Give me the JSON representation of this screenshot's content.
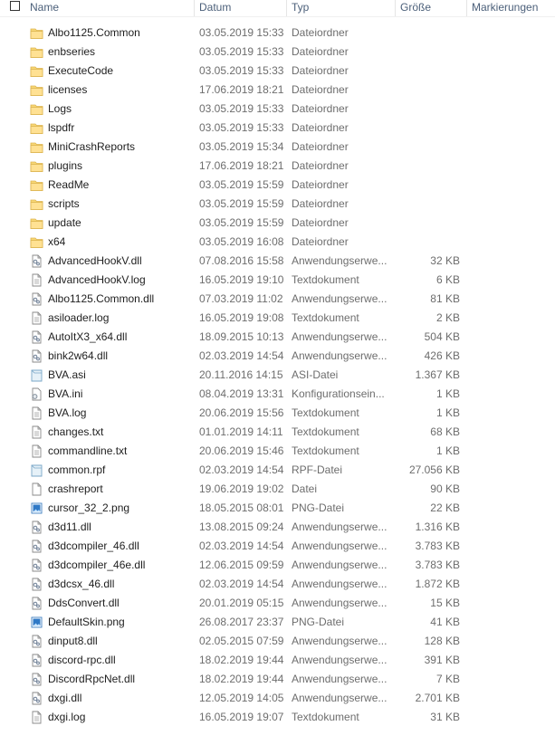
{
  "header": {
    "name": "Name",
    "date": "Datum",
    "type": "Typ",
    "size": "Größe",
    "tags": "Markierungen"
  },
  "files": [
    {
      "name": "Albo1125.Common",
      "date": "03.05.2019 15:33",
      "type": "Dateiordner",
      "size": "",
      "icon": "folder-icon"
    },
    {
      "name": "enbseries",
      "date": "03.05.2019 15:33",
      "type": "Dateiordner",
      "size": "",
      "icon": "folder-icon"
    },
    {
      "name": "ExecuteCode",
      "date": "03.05.2019 15:33",
      "type": "Dateiordner",
      "size": "",
      "icon": "folder-icon"
    },
    {
      "name": "licenses",
      "date": "17.06.2019 18:21",
      "type": "Dateiordner",
      "size": "",
      "icon": "folder-icon"
    },
    {
      "name": "Logs",
      "date": "03.05.2019 15:33",
      "type": "Dateiordner",
      "size": "",
      "icon": "folder-icon"
    },
    {
      "name": "lspdfr",
      "date": "03.05.2019 15:33",
      "type": "Dateiordner",
      "size": "",
      "icon": "folder-icon"
    },
    {
      "name": "MiniCrashReports",
      "date": "03.05.2019 15:34",
      "type": "Dateiordner",
      "size": "",
      "icon": "folder-icon"
    },
    {
      "name": "plugins",
      "date": "17.06.2019 18:21",
      "type": "Dateiordner",
      "size": "",
      "icon": "folder-icon"
    },
    {
      "name": "ReadMe",
      "date": "03.05.2019 15:59",
      "type": "Dateiordner",
      "size": "",
      "icon": "folder-icon"
    },
    {
      "name": "scripts",
      "date": "03.05.2019 15:59",
      "type": "Dateiordner",
      "size": "",
      "icon": "folder-icon"
    },
    {
      "name": "update",
      "date": "03.05.2019 15:59",
      "type": "Dateiordner",
      "size": "",
      "icon": "folder-icon"
    },
    {
      "name": "x64",
      "date": "03.05.2019 16:08",
      "type": "Dateiordner",
      "size": "",
      "icon": "folder-icon"
    },
    {
      "name": "AdvancedHookV.dll",
      "date": "07.08.2016 15:58",
      "type": "Anwendungserwe...",
      "size": "32 KB",
      "icon": "dll-icon"
    },
    {
      "name": "AdvancedHookV.log",
      "date": "16.05.2019 19:10",
      "type": "Textdokument",
      "size": "6 KB",
      "icon": "text-file-icon"
    },
    {
      "name": "Albo1125.Common.dll",
      "date": "07.03.2019 11:02",
      "type": "Anwendungserwe...",
      "size": "81 KB",
      "icon": "dll-icon"
    },
    {
      "name": "asiloader.log",
      "date": "16.05.2019 19:08",
      "type": "Textdokument",
      "size": "2 KB",
      "icon": "text-file-icon"
    },
    {
      "name": "AutoItX3_x64.dll",
      "date": "18.09.2015 10:13",
      "type": "Anwendungserwe...",
      "size": "504 KB",
      "icon": "dll-icon"
    },
    {
      "name": "bink2w64.dll",
      "date": "02.03.2019 14:54",
      "type": "Anwendungserwe...",
      "size": "426 KB",
      "icon": "dll-icon"
    },
    {
      "name": "BVA.asi",
      "date": "20.11.2016 14:15",
      "type": "ASI-Datei",
      "size": "1.367 KB",
      "icon": "generic-file-icon"
    },
    {
      "name": "BVA.ini",
      "date": "08.04.2019 13:31",
      "type": "Konfigurationsein...",
      "size": "1 KB",
      "icon": "settings-file-icon"
    },
    {
      "name": "BVA.log",
      "date": "20.06.2019 15:56",
      "type": "Textdokument",
      "size": "1 KB",
      "icon": "text-file-icon"
    },
    {
      "name": "changes.txt",
      "date": "01.01.2019 14:11",
      "type": "Textdokument",
      "size": "68 KB",
      "icon": "text-file-icon"
    },
    {
      "name": "commandline.txt",
      "date": "20.06.2019 15:46",
      "type": "Textdokument",
      "size": "1 KB",
      "icon": "text-file-icon"
    },
    {
      "name": "common.rpf",
      "date": "02.03.2019 14:54",
      "type": "RPF-Datei",
      "size": "27.056 KB",
      "icon": "generic-file-icon"
    },
    {
      "name": "crashreport",
      "date": "19.06.2019 19:02",
      "type": "Datei",
      "size": "90 KB",
      "icon": "blank-file-icon"
    },
    {
      "name": "cursor_32_2.png",
      "date": "18.05.2015 08:01",
      "type": "PNG-Datei",
      "size": "22 KB",
      "icon": "image-file-icon"
    },
    {
      "name": "d3d11.dll",
      "date": "13.08.2015 09:24",
      "type": "Anwendungserwe...",
      "size": "1.316 KB",
      "icon": "dll-icon"
    },
    {
      "name": "d3dcompiler_46.dll",
      "date": "02.03.2019 14:54",
      "type": "Anwendungserwe...",
      "size": "3.783 KB",
      "icon": "dll-icon"
    },
    {
      "name": "d3dcompiler_46e.dll",
      "date": "12.06.2015 09:59",
      "type": "Anwendungserwe...",
      "size": "3.783 KB",
      "icon": "dll-icon"
    },
    {
      "name": "d3dcsx_46.dll",
      "date": "02.03.2019 14:54",
      "type": "Anwendungserwe...",
      "size": "1.872 KB",
      "icon": "dll-icon"
    },
    {
      "name": "DdsConvert.dll",
      "date": "20.01.2019 05:15",
      "type": "Anwendungserwe...",
      "size": "15 KB",
      "icon": "dll-icon"
    },
    {
      "name": "DefaultSkin.png",
      "date": "26.08.2017 23:37",
      "type": "PNG-Datei",
      "size": "41 KB",
      "icon": "image-file-icon"
    },
    {
      "name": "dinput8.dll",
      "date": "02.05.2015 07:59",
      "type": "Anwendungserwe...",
      "size": "128 KB",
      "icon": "dll-icon"
    },
    {
      "name": "discord-rpc.dll",
      "date": "18.02.2019 19:44",
      "type": "Anwendungserwe...",
      "size": "391 KB",
      "icon": "dll-icon"
    },
    {
      "name": "DiscordRpcNet.dll",
      "date": "18.02.2019 19:44",
      "type": "Anwendungserwe...",
      "size": "7 KB",
      "icon": "dll-icon"
    },
    {
      "name": "dxgi.dll",
      "date": "12.05.2019 14:05",
      "type": "Anwendungserwe...",
      "size": "2.701 KB",
      "icon": "dll-icon"
    },
    {
      "name": "dxgi.log",
      "date": "16.05.2019 19:07",
      "type": "Textdokument",
      "size": "31 KB",
      "icon": "text-file-icon"
    }
  ]
}
